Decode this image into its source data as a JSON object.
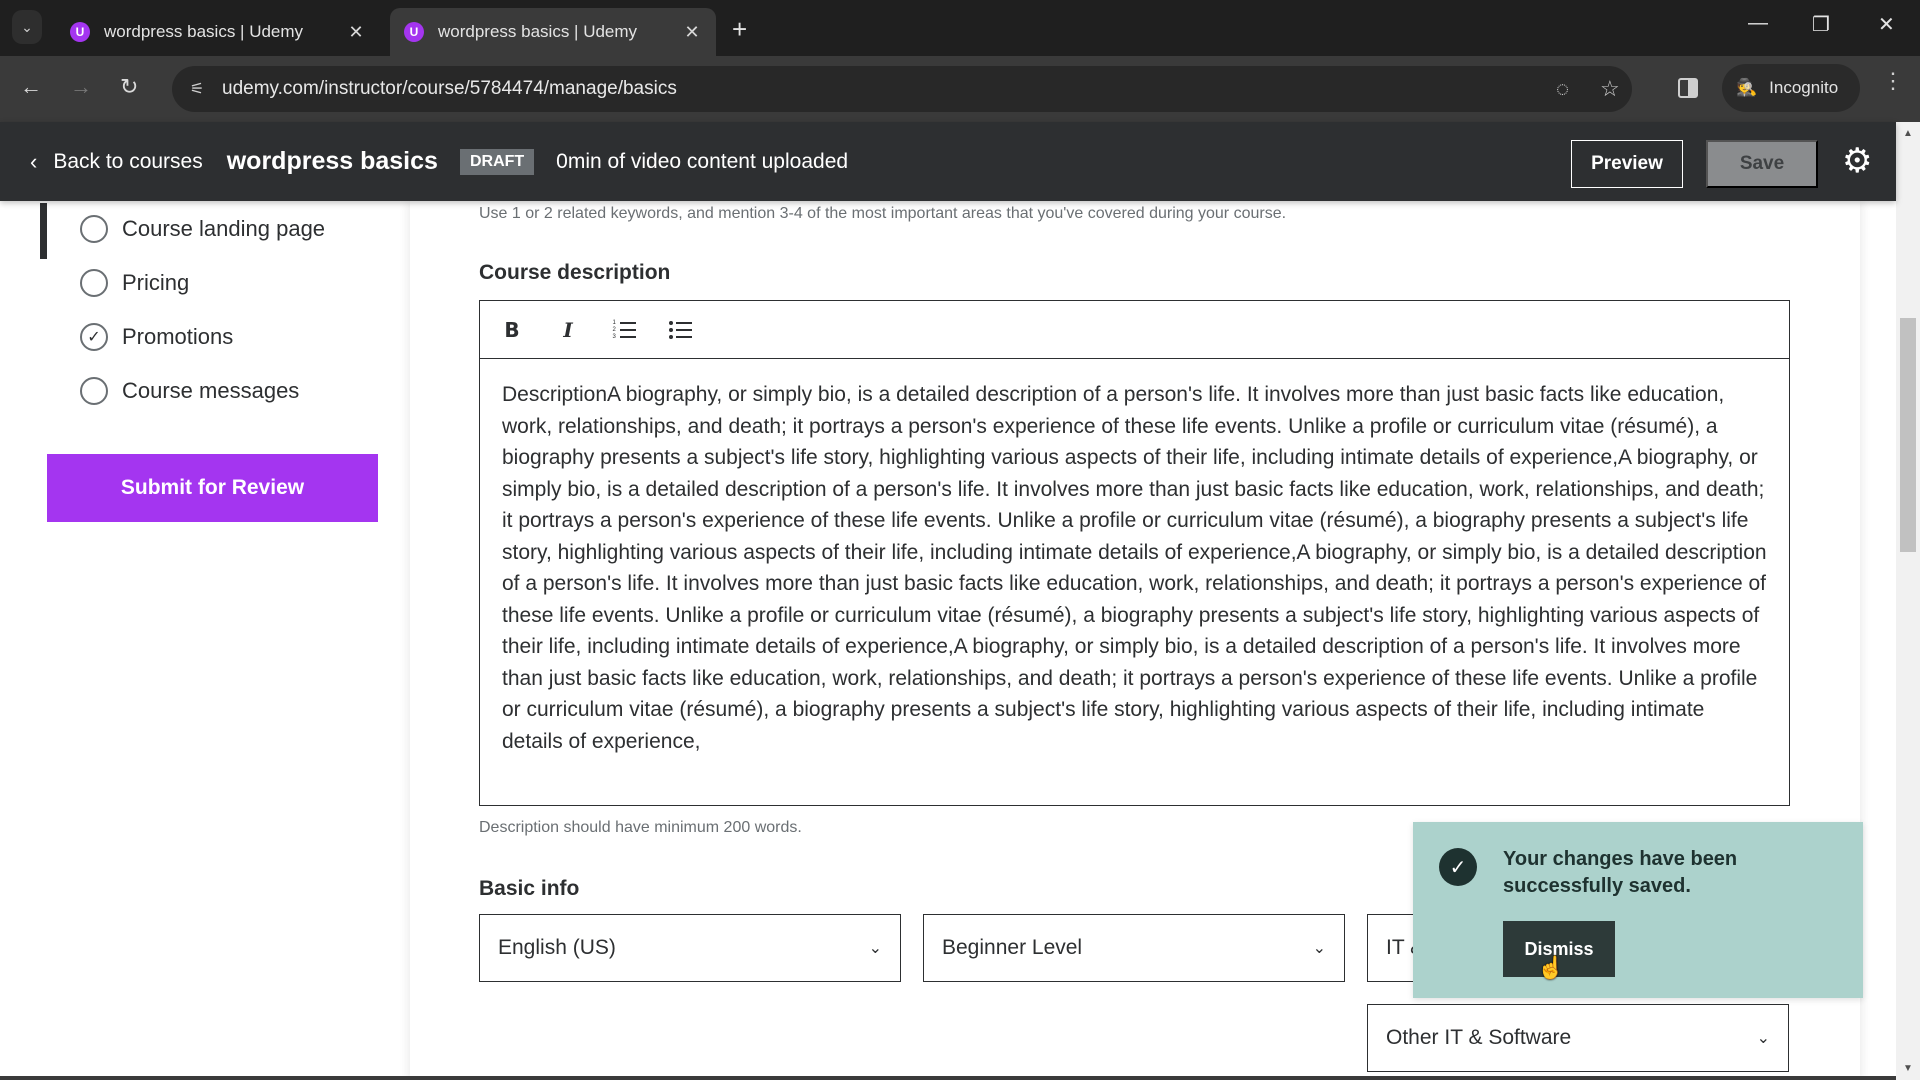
{
  "browser": {
    "tabs": [
      {
        "title": "wordpress basics | Udemy",
        "favicon": "U",
        "active": false
      },
      {
        "title": "wordpress basics | Udemy",
        "favicon": "U",
        "active": true
      }
    ],
    "url": "udemy.com/instructor/course/5784474/manage/basics",
    "profile_label": "Incognito",
    "icons": {
      "tab_dropdown": "⌄",
      "tab_close": "✕",
      "new_tab": "+",
      "minimize": "—",
      "restore": "❐",
      "close_window": "✕",
      "back": "←",
      "forward": "→",
      "reload": "↻",
      "site_info": "⚟",
      "eye_off": "◌",
      "star": "☆",
      "incognito": "🕵",
      "menu": "⋮"
    }
  },
  "header": {
    "back_label": "Back to courses",
    "back_icon": "‹",
    "course_title": "wordpress basics",
    "status_badge": "DRAFT",
    "video_status": "0min of video content uploaded",
    "preview_label": "Preview",
    "save_label": "Save",
    "settings_icon": "⚙"
  },
  "sidebar": {
    "items": [
      {
        "label": "Course landing page",
        "checked": false,
        "active": true
      },
      {
        "label": "Pricing",
        "checked": false,
        "active": false
      },
      {
        "label": "Promotions",
        "checked": true,
        "active": false
      },
      {
        "label": "Course messages",
        "checked": false,
        "active": false
      }
    ],
    "check_glyph": "✓",
    "submit_label": "Submit for Review"
  },
  "main": {
    "subtitle_helper": "Use 1 or 2 related keywords, and mention 3-4 of the most important areas that you've covered during your course.",
    "description": {
      "label": "Course description",
      "toolbar": {
        "bold": "B",
        "italic": "I",
        "ordered_list": "1 2 3",
        "bullet_list": "•"
      },
      "text": "DescriptionA biography, or simply bio, is a detailed description of a person's life. It involves more than just basic facts like education, work, relationships, and death; it portrays a person's experience of these life events. Unlike a profile or curriculum vitae (résumé), a biography presents a subject's life story, highlighting various aspects of their life, including intimate details of experience,A biography, or simply bio, is a detailed description of a person's life. It involves more than just basic facts like education, work, relationships, and death; it portrays a person's experience of these life events. Unlike a profile or curriculum vitae (résumé), a biography presents a subject's life story, highlighting various aspects of their life, including intimate details of experience,A biography, or simply bio, is a detailed description of a person's life. It involves more than just basic facts like education, work, relationships, and death; it portrays a person's experience of these life events. Unlike a profile or curriculum vitae (résumé), a biography presents a subject's life story, highlighting various aspects of their life, including intimate details of experience,A biography, or simply bio, is a detailed description of a person's life. It involves more than just basic facts like education, work, relationships, and death; it portrays a person's experience of these life events. Unlike a profile or curriculum vitae (résumé), a biography presents a subject's life story, highlighting various aspects of their life, including intimate details of experience,",
      "helper": "Description should have minimum 200 words."
    },
    "basic_info": {
      "label": "Basic info",
      "language": "English (US)",
      "level": "Beginner Level",
      "category": "IT & Software",
      "subcategory": "Other IT & Software",
      "caret": "⌄"
    }
  },
  "toast": {
    "icon": "✓",
    "message": "Your changes have been successfully saved.",
    "dismiss_label": "Dismiss"
  },
  "scrollbar": {
    "up": "▲",
    "down": "▼"
  },
  "colors": {
    "brand_purple": "#a435f0",
    "header_dark": "#2d2f31",
    "toast_bg": "#acd2cc",
    "draft_badge": "#6a6f73"
  }
}
